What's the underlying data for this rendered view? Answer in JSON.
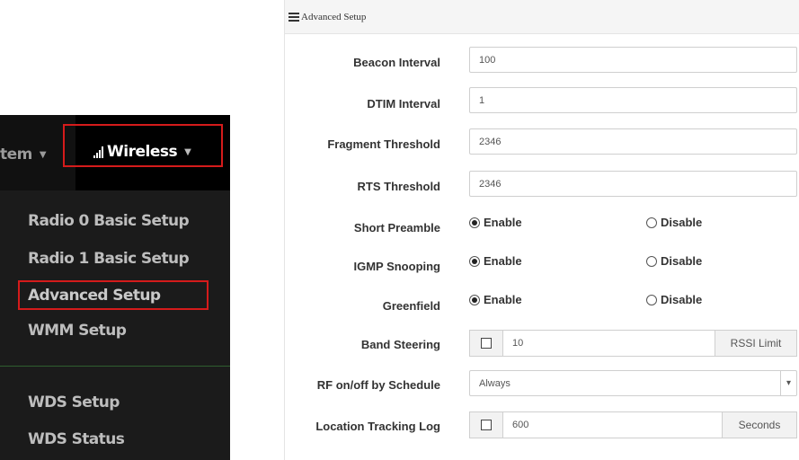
{
  "nav": {
    "system_tab": "tem",
    "wireless_tab": "Wireless",
    "items": [
      {
        "label": "Radio 0 Basic Setup"
      },
      {
        "label": "Radio 1 Basic Setup"
      },
      {
        "label": "Advanced Setup"
      },
      {
        "label": "WMM Setup"
      },
      {
        "label": "WDS Setup"
      },
      {
        "label": "WDS Status"
      }
    ]
  },
  "panel": {
    "title": "Advanced Setup",
    "fields": {
      "beacon_interval": {
        "label": "Beacon Interval",
        "value": "100"
      },
      "dtim_interval": {
        "label": "DTIM Interval",
        "value": "1"
      },
      "fragment_threshold": {
        "label": "Fragment Threshold",
        "value": "2346"
      },
      "rts_threshold": {
        "label": "RTS Threshold",
        "value": "2346"
      },
      "short_preamble": {
        "label": "Short Preamble",
        "enable": "Enable",
        "disable": "Disable",
        "selected": "Enable"
      },
      "igmp_snooping": {
        "label": "IGMP Snooping",
        "enable": "Enable",
        "disable": "Disable",
        "selected": "Enable"
      },
      "greenfield": {
        "label": "Greenfield",
        "enable": "Enable",
        "disable": "Disable",
        "selected": "Enable"
      },
      "band_steering": {
        "label": "Band Steering",
        "value": "10",
        "suffix": "RSSI Limit",
        "checked": false
      },
      "rf_schedule": {
        "label": "RF on/off by Schedule",
        "value": "Always"
      },
      "location_tracking": {
        "label": "Location Tracking Log",
        "value": "600",
        "suffix": "Seconds",
        "checked": false
      }
    }
  }
}
